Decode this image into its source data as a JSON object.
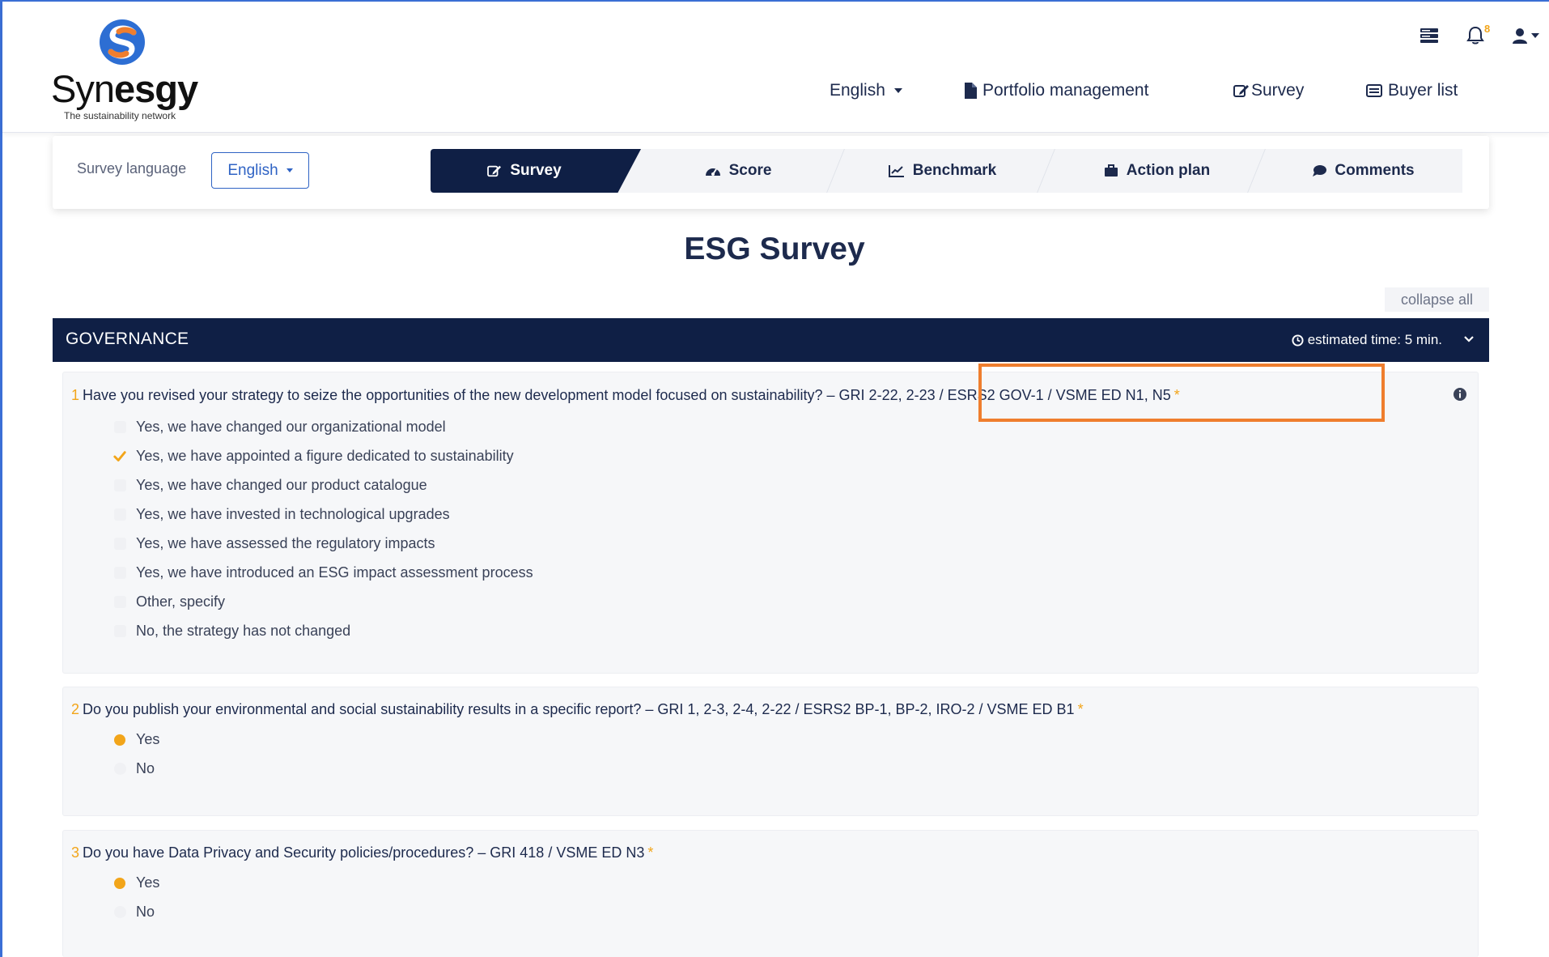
{
  "brand": {
    "name_light": "Syn",
    "name_bold": "esgy",
    "tagline": "The sustainability network",
    "colors": {
      "blue": "#2d6ed3",
      "orange": "#ef7e2e",
      "navy": "#0f1f45",
      "accent": "#f2a51a"
    }
  },
  "top_icons": {
    "notifications_count": "8"
  },
  "nav": {
    "language": "English",
    "portfolio": "Portfolio management",
    "survey": "Survey",
    "buyer_list": "Buyer list"
  },
  "subbar": {
    "language_label": "Survey language",
    "language_value": "English",
    "tabs": [
      {
        "label": "Survey",
        "icon": "edit-icon",
        "active": true
      },
      {
        "label": "Score",
        "icon": "dashboard-icon",
        "active": false
      },
      {
        "label": "Benchmark",
        "icon": "line-chart-icon",
        "active": false
      },
      {
        "label": "Action plan",
        "icon": "briefcase-icon",
        "active": false
      },
      {
        "label": "Comments",
        "icon": "comment-icon",
        "active": false
      }
    ]
  },
  "page_title": "ESG Survey",
  "collapse_all": "collapse all",
  "section": {
    "title": "GOVERNANCE",
    "estimated_time": "estimated time: 5 min."
  },
  "questions": [
    {
      "number": "1",
      "text": "Have you revised your strategy to seize the opportunities of the new development model focused on sustainability? – GRI 2-22, 2-23 / ESRS2 GOV-1 / VSME ED N1, N5",
      "required": "*",
      "type": "checkbox",
      "options": [
        {
          "label": "Yes, we have changed our organizational model",
          "selected": false
        },
        {
          "label": "Yes, we have appointed a figure dedicated to sustainability",
          "selected": true
        },
        {
          "label": "Yes, we have changed our product catalogue",
          "selected": false
        },
        {
          "label": "Yes, we have invested in technological upgrades",
          "selected": false
        },
        {
          "label": "Yes, we have assessed the regulatory impacts",
          "selected": false
        },
        {
          "label": "Yes, we have introduced an ESG impact assessment process",
          "selected": false
        },
        {
          "label": "Other, specify",
          "selected": false
        },
        {
          "label": "No, the strategy has not changed",
          "selected": false
        }
      ]
    },
    {
      "number": "2",
      "text": "Do you publish your environmental and social sustainability results in a specific report? – GRI 1, 2-3, 2-4, 2-22 / ESRS2 BP-1, BP-2, IRO-2 / VSME ED B1",
      "required": "*",
      "type": "radio",
      "options": [
        {
          "label": "Yes",
          "selected": true
        },
        {
          "label": "No",
          "selected": false
        }
      ]
    },
    {
      "number": "3",
      "text": "Do you have Data Privacy and Security policies/procedures? – GRI 418 / VSME ED N3",
      "required": "*",
      "type": "radio",
      "options": [
        {
          "label": "Yes",
          "selected": true
        },
        {
          "label": "No",
          "selected": false
        }
      ]
    }
  ]
}
